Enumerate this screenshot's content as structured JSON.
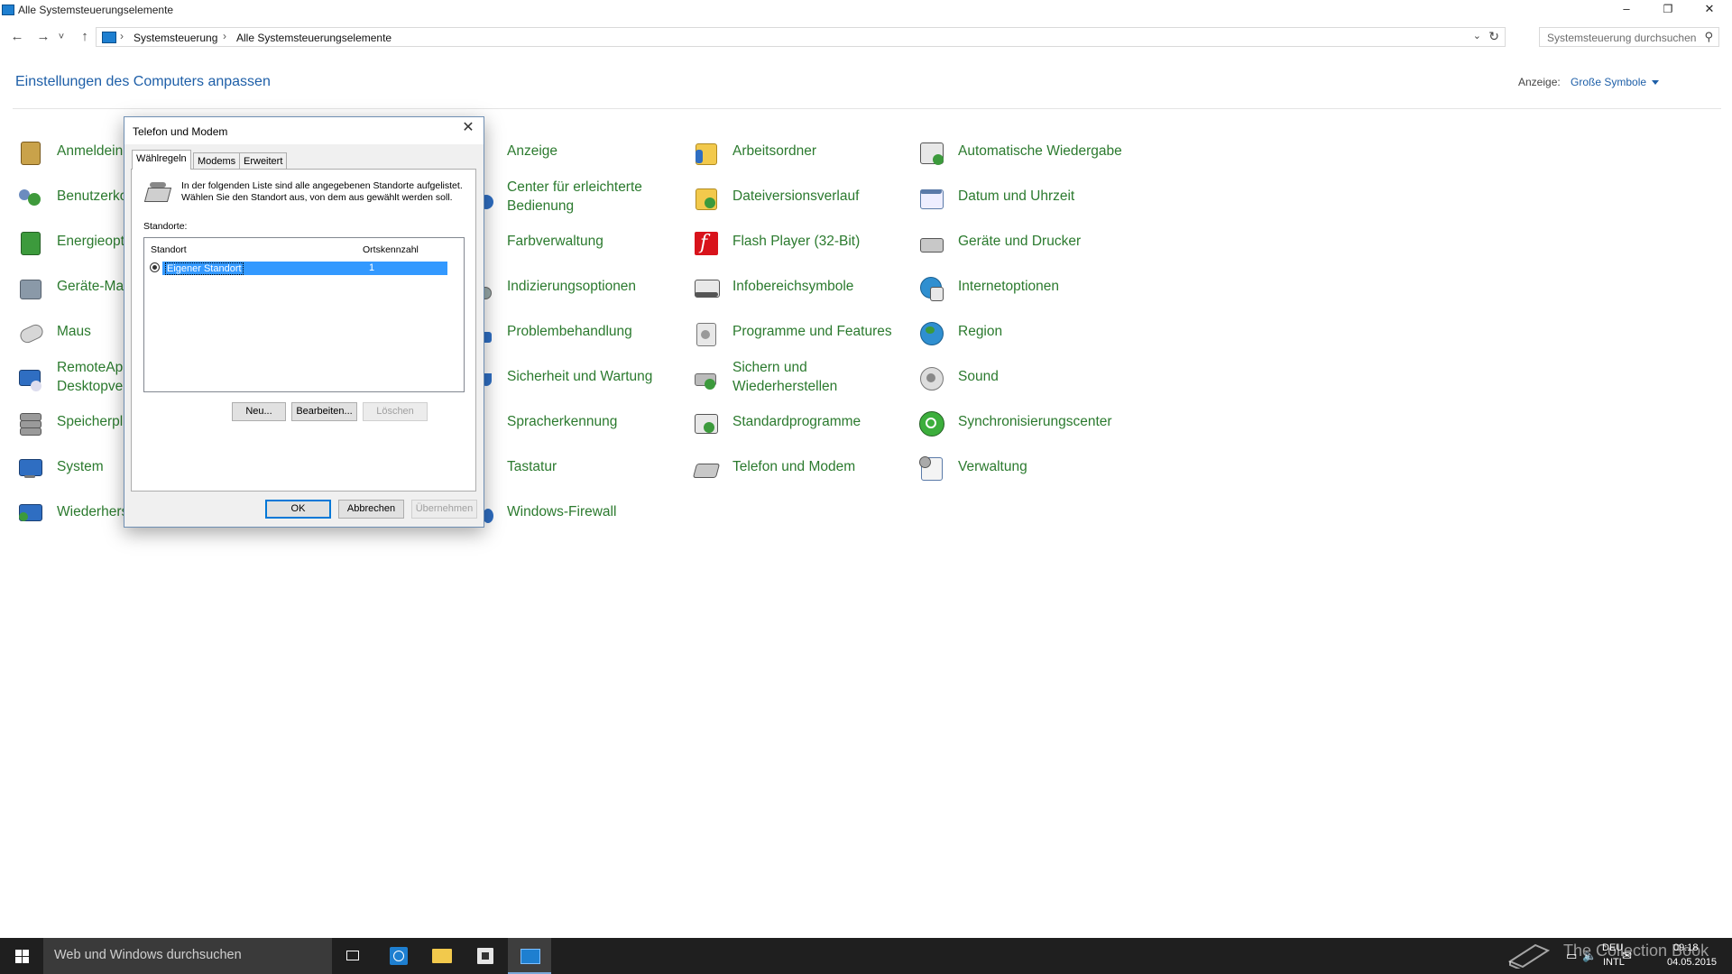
{
  "window": {
    "title": "Alle Systemsteuerungselemente",
    "minimize": "–",
    "maximize": "❐",
    "close": "✕"
  },
  "navbar": {
    "back": "←",
    "forward": "→",
    "recent": "˅",
    "up": "↑",
    "breadcrumb": [
      "Systemsteuerung",
      "Alle Systemsteuerungselemente"
    ],
    "separator": "›",
    "search_placeholder": "Systemsteuerung durchsuchen"
  },
  "header": {
    "title": "Einstellungen des Computers anpassen",
    "view_label": "Anzeige:",
    "view_value": "Große Symbole"
  },
  "items": {
    "col1": [
      "Anmeldein",
      "Benutzerko",
      "Energieopt",
      "Geräte-Ma",
      "Maus",
      "RemoteApp\nDesktopver",
      "Speicherpl",
      "System",
      "Wiederhers"
    ],
    "col2": [
      "Anzeige",
      "Center für erleichterte Bedienung",
      "Farbverwaltung",
      "Indizierungsoptionen",
      "Problembehandlung",
      "Sicherheit und Wartung",
      "Spracherkennung",
      "Tastatur",
      "Windows-Firewall"
    ],
    "col3": [
      "Arbeitsordner",
      "Dateiversionsverlauf",
      "Flash Player (32-Bit)",
      "Infobereichsymbole",
      "Programme und Features",
      "Sichern und Wiederherstellen",
      "Standardprogramme",
      "Telefon und Modem"
    ],
    "col4": [
      "Automatische Wiedergabe",
      "Datum und Uhrzeit",
      "Geräte und Drucker",
      "Internetoptionen",
      "Region",
      "Sound",
      "Synchronisierungscenter",
      "Verwaltung"
    ]
  },
  "dialog": {
    "title": "Telefon und Modem",
    "close": "✕",
    "tabs": [
      "Wählregeln",
      "Modems",
      "Erweitert"
    ],
    "description": "In der folgenden Liste sind alle angegebenen Standorte aufgelistet. Wählen Sie den Standort aus, von dem aus gewählt werden soll.",
    "locations_label": "Standorte:",
    "columns": [
      "Standort",
      "Ortskennzahl"
    ],
    "rows": [
      {
        "name": "Eigener Standort",
        "code": "1"
      }
    ],
    "buttons": {
      "new": "Neu...",
      "edit": "Bearbeiten...",
      "delete": "Löschen"
    },
    "footer": {
      "ok": "OK",
      "cancel": "Abbrechen",
      "apply": "Übernehmen"
    }
  },
  "taskbar": {
    "search_placeholder": "Web und Windows durchsuchen",
    "lang_primary": "DEU",
    "lang_secondary": "INTL",
    "time": "09:18",
    "date": "04.05.2015"
  },
  "watermark": "The Collection Book",
  "colors": {
    "link_green": "#2b7a2e",
    "title_blue": "#1e5fa8",
    "selection": "#3399ff",
    "taskbar": "#1f1f1f"
  }
}
